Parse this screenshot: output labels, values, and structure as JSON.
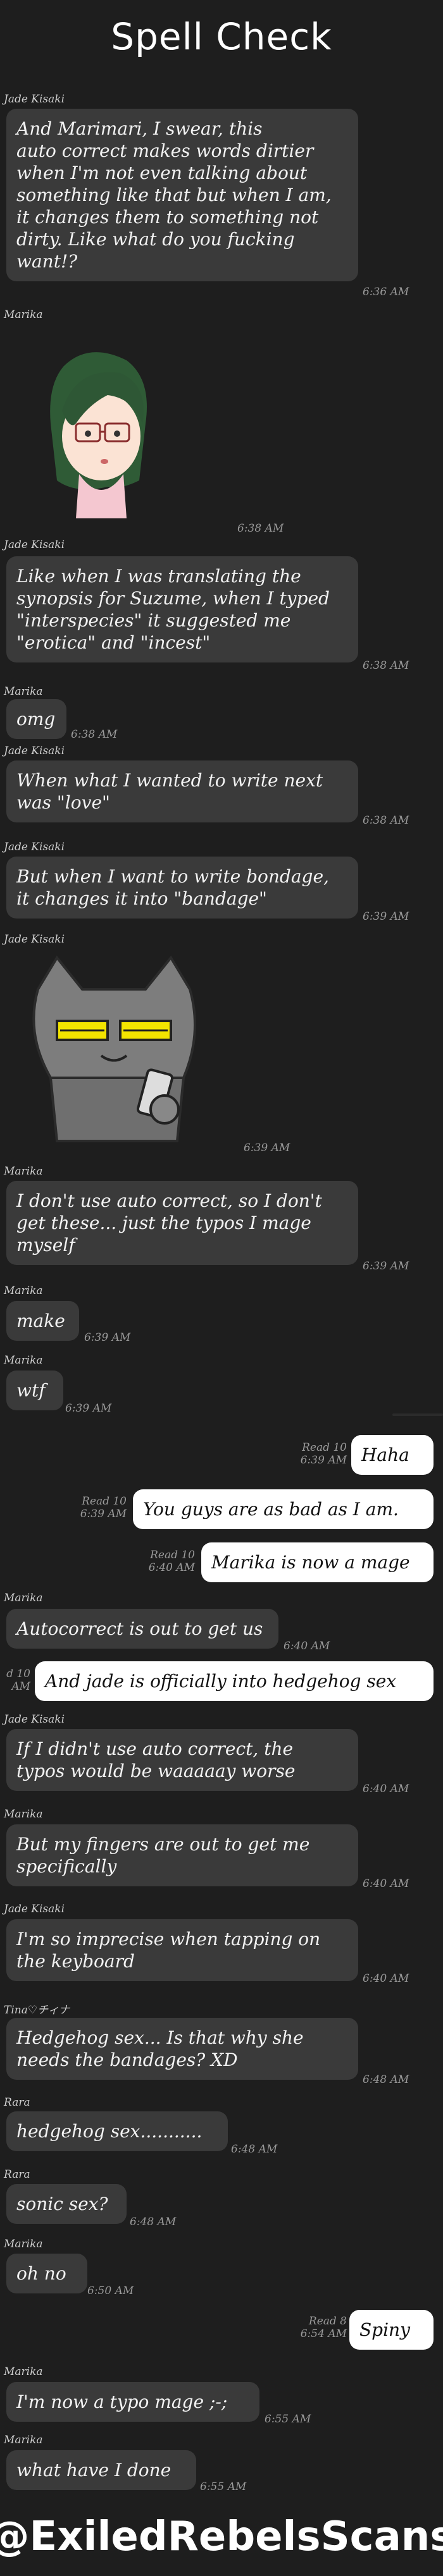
{
  "title": "Spell Check",
  "footer": "@ExiledRebelsScans",
  "messages": [
    {
      "sender": "Jade Kisaki",
      "text": "And Marimari, I swear, this\nauto correct makes words dirtier\nwhen I'm not even talking about\nsomething like that but when I am,\nit changes them to something not\ndirty. Like what do you fucking\nwant!?",
      "time": "6:36 AM"
    },
    {
      "sender": "Marika",
      "time": "6:38 AM"
    },
    {
      "sender": "Jade Kisaki",
      "text": "Like when I was translating the\nsynopsis for Suzume, when I typed\n\"interspecies\" it suggested me\n\"erotica\" and \"incest\"",
      "time": "6:38 AM"
    },
    {
      "sender": "Marika",
      "text": "omg",
      "time": "6:38 AM"
    },
    {
      "sender": "Jade Kisaki",
      "text": "When what I wanted to write next\nwas \"love\"",
      "time": "6:38 AM"
    },
    {
      "sender": "Jade Kisaki",
      "text": "But when I want to write bondage,\nit changes it into \"bandage\"",
      "time": "6:39 AM"
    },
    {
      "sender": "Jade Kisaki",
      "time": "6:39 AM"
    },
    {
      "sender": "Marika",
      "text": "I don't use auto correct, so I don't\nget these... just the typos I mage\nmyself",
      "time": "6:39 AM"
    },
    {
      "sender": "Marika",
      "text": "make",
      "time": "6:39 AM"
    },
    {
      "sender": "Marika",
      "text": "wtf",
      "time": "6:39 AM"
    },
    {
      "text": "Haha",
      "read": "Read 10",
      "time": "6:39 AM"
    },
    {
      "text": "You guys are as bad as I am.",
      "read": "Read 10",
      "time": "6:39 AM"
    },
    {
      "text": "Marika is now a mage",
      "read": "Read 10",
      "time": "6:40 AM"
    },
    {
      "sender": "Marika",
      "text": "Autocorrect is out to get us",
      "time": "6:40 AM"
    },
    {
      "text": "And jade is officially into hedgehog sex",
      "read": "d 10",
      "time": "AM"
    },
    {
      "sender": "Jade Kisaki",
      "text": "If I didn't use auto correct, the\ntypos would be waaaaay worse",
      "time": "6:40 AM"
    },
    {
      "sender": "Marika",
      "text": "But my fingers are out to get me\nspecifically",
      "time": "6:40 AM"
    },
    {
      "sender": "Jade Kisaki",
      "text": "I'm so imprecise when tapping on\nthe keyboard",
      "time": "6:40 AM"
    },
    {
      "sender": "Tina♡チィナ",
      "text": "Hedgehog sex... Is that why she\nneeds the bandages? XD",
      "time": "6:48 AM"
    },
    {
      "sender": "Rara",
      "text": "hedgehog sex...........",
      "time": "6:48 AM"
    },
    {
      "sender": "Rara",
      "text": "sonic sex?",
      "time": "6:48 AM"
    },
    {
      "sender": "Marika",
      "text": "oh no",
      "time": "6:50 AM"
    },
    {
      "text": "Spiny",
      "read": "Read 8",
      "time": "6:54 AM"
    },
    {
      "sender": "Marika",
      "text": "I'm now a typo mage ;-;",
      "time": "6:55 AM"
    },
    {
      "sender": "Marika",
      "text": "what have I done",
      "time": "6:55 AM"
    }
  ]
}
